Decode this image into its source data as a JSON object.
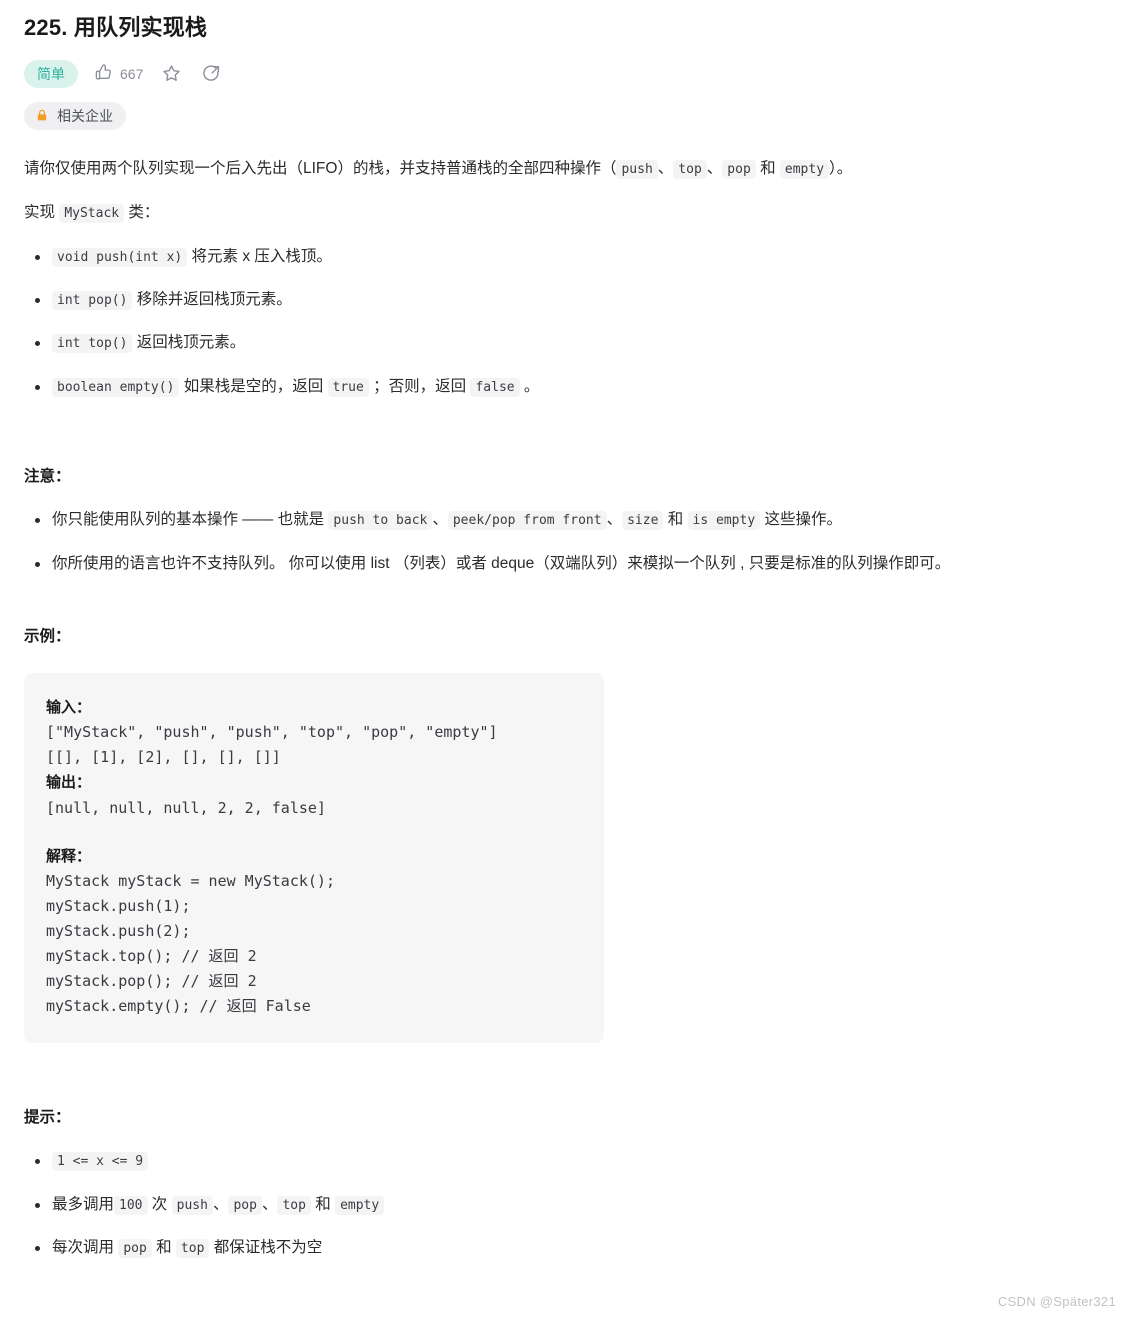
{
  "problem": {
    "title": "225. 用队列实现栈",
    "difficulty": "简单",
    "likes": "667",
    "company_tag": "相关企业"
  },
  "icons": {
    "thumbs_up": "thumbs-up-icon",
    "star": "star-icon",
    "share": "share-icon",
    "lock": "lock-icon"
  },
  "description": {
    "intro_1": "请你仅使用两个队列实现一个后入先出（LIFO）的栈，并支持普通栈的全部四种操作（",
    "code_push": "push",
    "sep_1": "、",
    "code_top": "top",
    "sep_2": "、",
    "code_pop": "pop",
    "sep_3": " 和 ",
    "code_empty": "empty",
    "intro_2": "）。",
    "implement_pre": "实现 ",
    "implement_code": "MyStack",
    "implement_post": " 类："
  },
  "methods": [
    {
      "code": "void push(int x)",
      "text": " 将元素 x 压入栈顶。"
    },
    {
      "code": "int pop()",
      "text": " 移除并返回栈顶元素。"
    },
    {
      "code": "int top()",
      "text": " 返回栈顶元素。"
    }
  ],
  "method_empty": {
    "code": "boolean empty()",
    "text_1": " 如果栈是空的，返回 ",
    "code_true": "true",
    "text_2": " ；否则，返回 ",
    "code_false": "false",
    "text_3": " 。"
  },
  "notes": {
    "heading": "注意：",
    "item1": {
      "t1": "你只能使用队列的基本操作 —— 也就是 ",
      "c1": "push to back",
      "t2": "、",
      "c2": "peek/pop from front",
      "t3": "、",
      "c3": "size",
      "t4": " 和 ",
      "c4": "is empty",
      "t5": " 这些操作。"
    },
    "item2": "你所使用的语言也许不支持队列。 你可以使用 list （列表）或者 deque（双端队列）来模拟一个队列 , 只要是标准的队列操作即可。"
  },
  "example": {
    "heading": "示例：",
    "input_label": "输入：",
    "input_line1": "[\"MyStack\", \"push\", \"push\", \"top\", \"pop\", \"empty\"]",
    "input_line2": "[[], [1], [2], [], [], []]",
    "output_label": "输出：",
    "output_line": "[null, null, null, 2, 2, false]",
    "explain_label": "解释：",
    "explain_lines": "MyStack myStack = new MyStack();\nmyStack.push(1);\nmyStack.push(2);\nmyStack.top(); // 返回 2\nmyStack.pop(); // 返回 2\nmyStack.empty(); // 返回 False"
  },
  "hints": {
    "heading": "提示：",
    "item1_code": "1 <= x <= 9",
    "item2": {
      "t1": "最多调用",
      "c1": "100",
      "t2": " 次 ",
      "c2": "push",
      "t3": "、",
      "c3": "pop",
      "t4": "、",
      "c4": "top",
      "t5": " 和 ",
      "c5": "empty"
    },
    "item3": {
      "t1": "每次调用 ",
      "c1": "pop",
      "t2": " 和 ",
      "c2": "top",
      "t3": " 都保证栈不为空"
    }
  },
  "watermark": "CSDN @Später321",
  "colors": {
    "difficulty_bg": "#d9f2ec",
    "difficulty_fg": "#2db39a",
    "code_bg": "#f6f6f7",
    "inline_code_bg": "#f4f4f5",
    "lock": "#f0a02a"
  }
}
